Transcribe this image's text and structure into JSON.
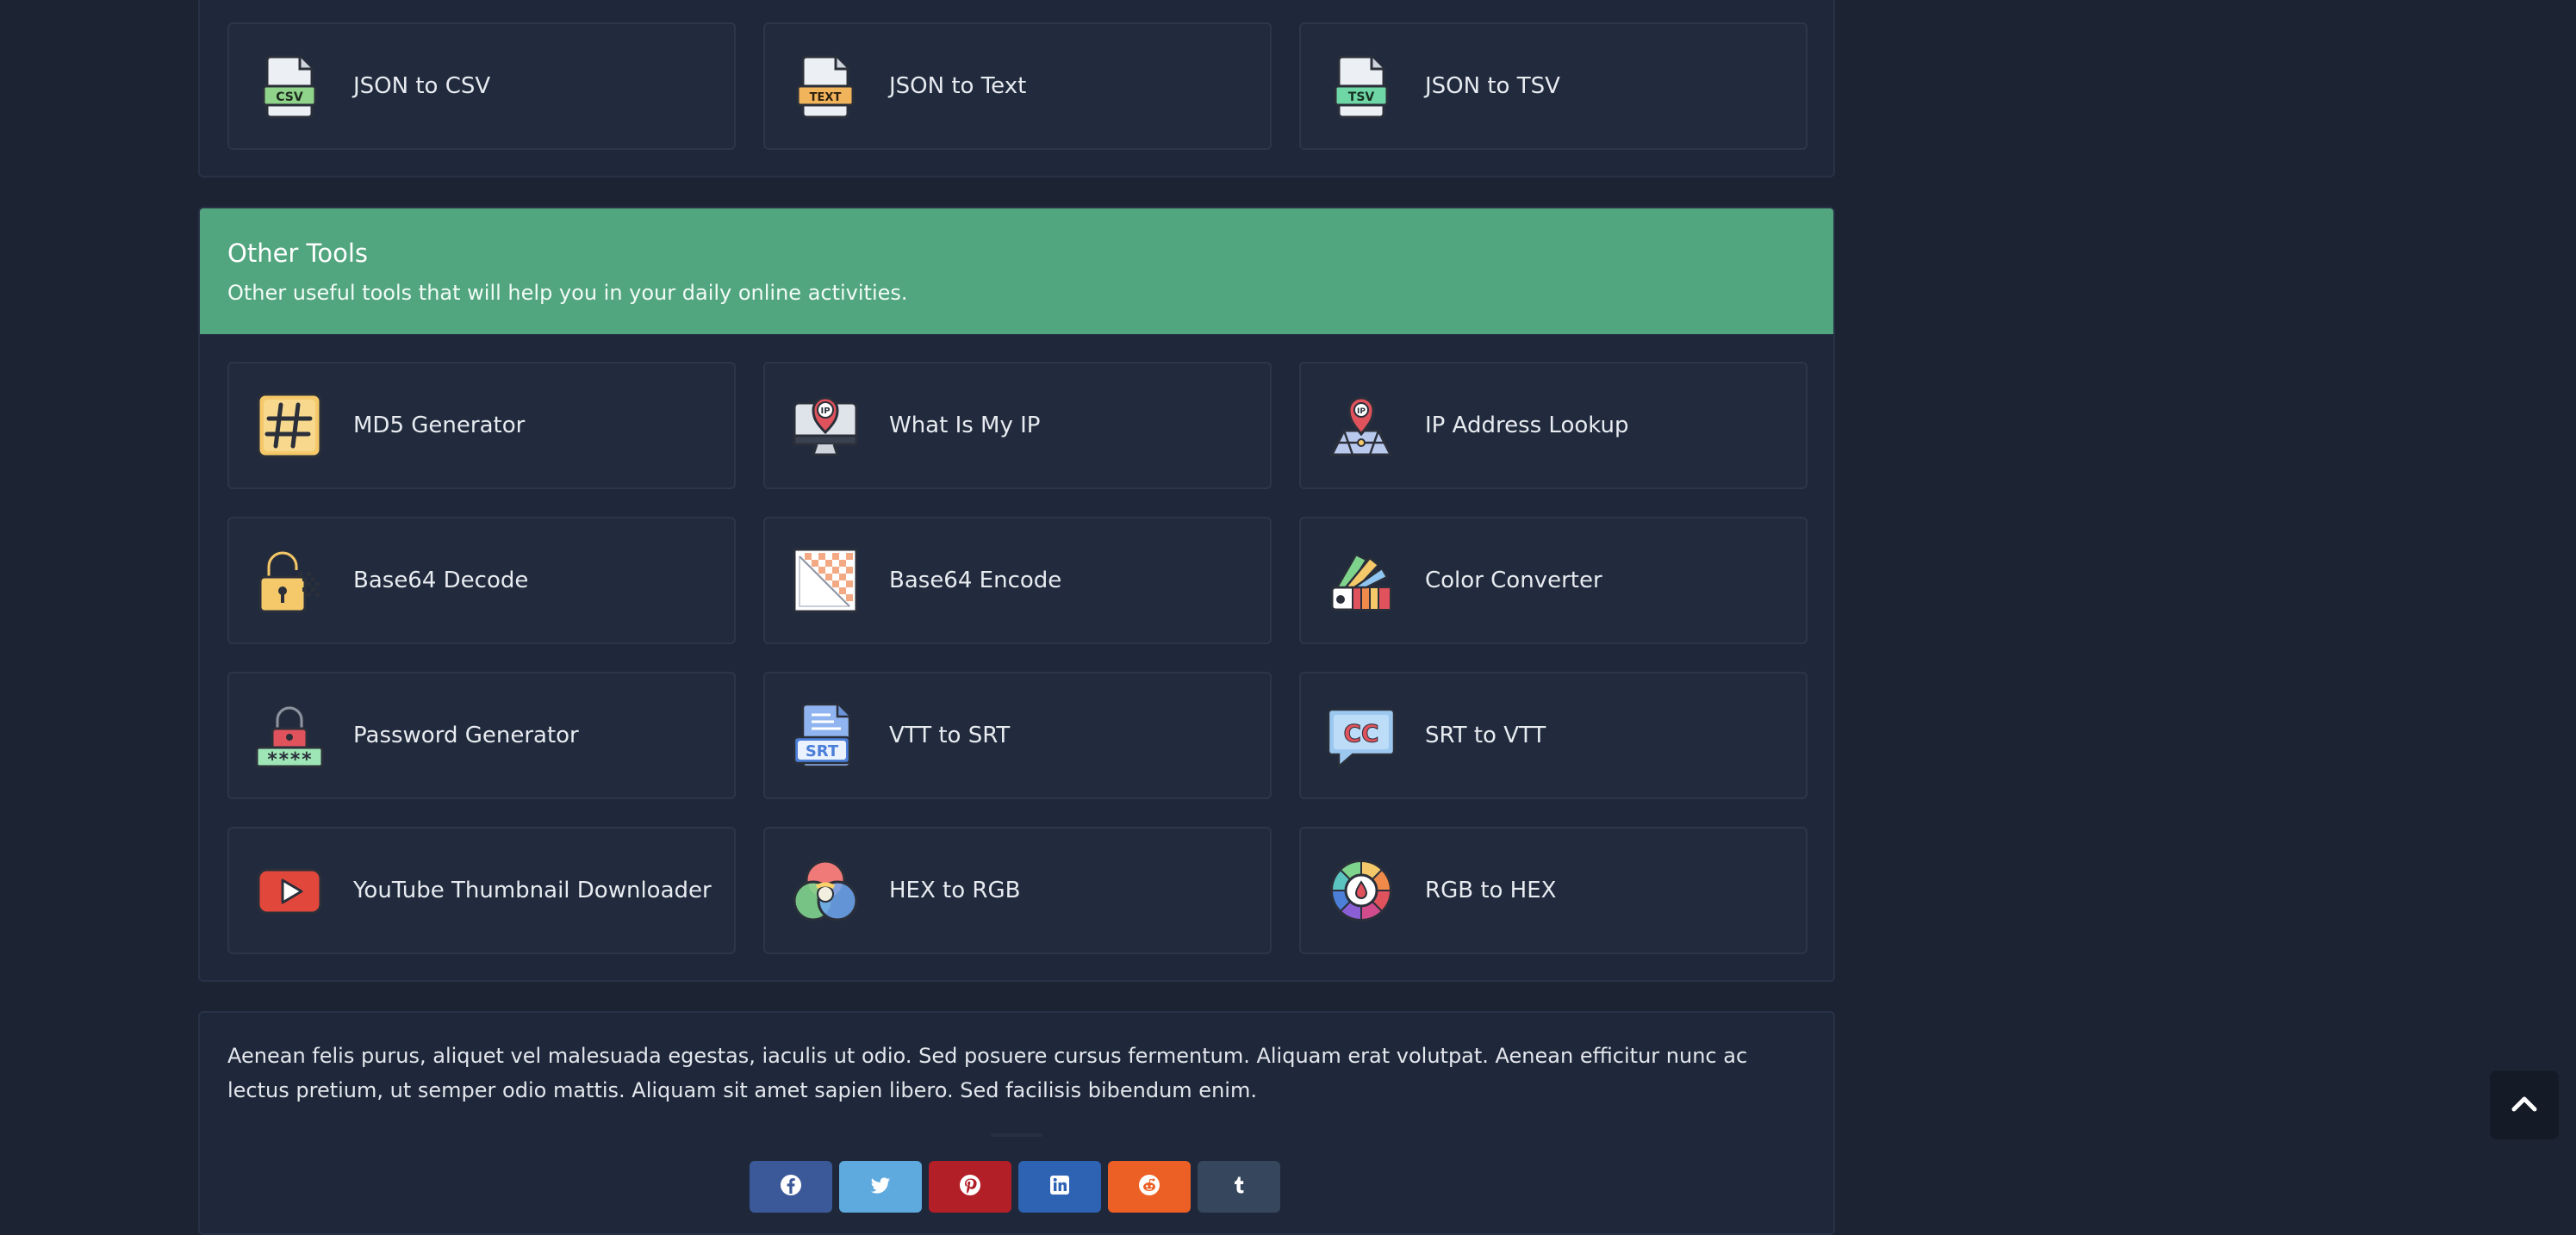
{
  "top_tools": [
    {
      "label": "JSON to CSV",
      "icon": "csv-file-icon",
      "badge": "CSV"
    },
    {
      "label": "JSON to Text",
      "icon": "text-file-icon",
      "badge": "TEXT"
    },
    {
      "label": "JSON to TSV",
      "icon": "tsv-file-icon",
      "badge": "TSV"
    }
  ],
  "other_tools": {
    "title": "Other Tools",
    "subtitle": "Other useful tools that will help you in your daily online activities.",
    "items": [
      {
        "label": "MD5 Generator",
        "icon": "hash-icon"
      },
      {
        "label": "What Is My IP",
        "icon": "monitor-ip-icon",
        "badge": "IP"
      },
      {
        "label": "IP Address Lookup",
        "icon": "ip-location-icon",
        "badge": "IP"
      },
      {
        "label": "Base64 Decode",
        "icon": "unlock-icon"
      },
      {
        "label": "Base64 Encode",
        "icon": "checkered-image-icon"
      },
      {
        "label": "Color Converter",
        "icon": "color-palette-icon"
      },
      {
        "label": "Password Generator",
        "icon": "password-lock-icon",
        "badge": "****"
      },
      {
        "label": "VTT to SRT",
        "icon": "srt-file-icon",
        "badge": "SRT"
      },
      {
        "label": "SRT to VTT",
        "icon": "cc-bubble-icon",
        "badge": "CC"
      },
      {
        "label": "YouTube Thumbnail Downloader",
        "icon": "youtube-play-icon"
      },
      {
        "label": "HEX to RGB",
        "icon": "rgb-circles-icon"
      },
      {
        "label": "RGB to HEX",
        "icon": "color-wheel-icon"
      }
    ]
  },
  "about": {
    "text": "Aenean felis purus, aliquet vel malesuada egestas, iaculis ut odio. Sed posuere cursus fermentum. Aliquam erat volutpat. Aenean efficitur nunc ac lectus pretium, ut semper odio mattis. Aliquam sit amet sapien libero. Sed facilisis bibendum enim."
  },
  "share": [
    {
      "network": "facebook",
      "icon": "facebook-icon",
      "color": "#3b5998"
    },
    {
      "network": "twitter",
      "icon": "twitter-icon",
      "color": "#5ea9dd"
    },
    {
      "network": "pinterest",
      "icon": "pinterest-icon",
      "color": "#b31f27"
    },
    {
      "network": "linkedin",
      "icon": "linkedin-icon",
      "color": "#2e63b4"
    },
    {
      "network": "reddit",
      "icon": "reddit-icon",
      "color": "#ec5f25"
    },
    {
      "network": "tumblr",
      "icon": "tumblr-icon",
      "color": "#35465d"
    }
  ],
  "colors": {
    "page_bg": "#1c2333",
    "panel_bg": "#1f283a",
    "header_green": "#52a67f"
  }
}
